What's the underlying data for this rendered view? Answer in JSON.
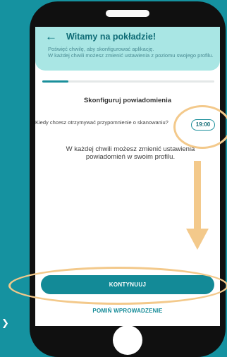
{
  "header": {
    "title": "Witamy na pokładzie!",
    "subtitle": "Poświęć chwilę, aby skonfigurować aplikację.\nW każdej chwili możesz zmienić ustawienia z poziomu swojego profilu."
  },
  "progress": 0.15,
  "section": {
    "title": "Skonfiguruj powiadomienia"
  },
  "reminder": {
    "label": "Kiedy chcesz otrzymywać przypomnienie o skanowaniu?",
    "time": "19:00"
  },
  "info": "W każdej chwili możesz zmienić ustawienia powiadomień w swoim profilu.",
  "actions": {
    "continue": "KONTYNUUJ",
    "skip": "POMIŃ WPROWADZENIE"
  },
  "colors": {
    "background": "#1592a0",
    "header": "#a9e6e4",
    "accent": "#138a97",
    "annotation": "#f3c98b"
  }
}
